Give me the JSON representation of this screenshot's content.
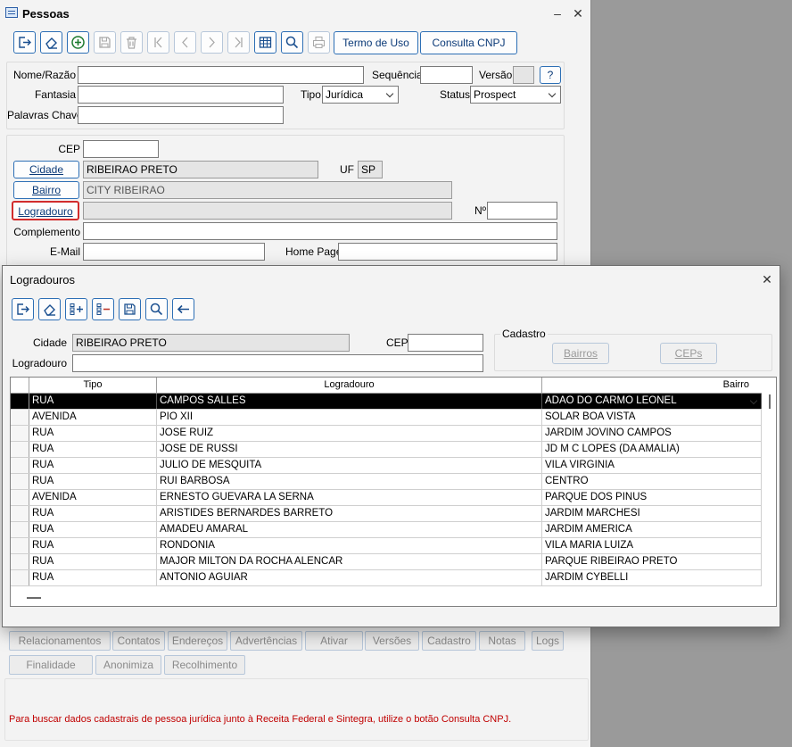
{
  "main": {
    "title": "Pessoas",
    "toolbar": {
      "termo_label": "Termo de Uso",
      "consulta_label": "Consulta CNPJ"
    },
    "form": {
      "nome_label": "Nome/Razão",
      "nome_value": "",
      "sequencia_label": "Sequência",
      "sequencia_value": "",
      "versao_label": "Versão",
      "versao_value": "",
      "help_label": "?",
      "fantasia_label": "Fantasia",
      "fantasia_value": "",
      "tipo_label": "Tipo",
      "tipo_value": "Jurídica",
      "status_label": "Status",
      "status_value": "Prospect",
      "palavras_label": "Palavras Chave",
      "palavras_value": ""
    },
    "address": {
      "cep_label": "CEP",
      "cep_value": "",
      "cidade_btn": "Cidade",
      "cidade_value": "RIBEIRAO PRETO",
      "uf_label": "UF",
      "uf_value": "SP",
      "bairro_btn": "Bairro",
      "bairro_value": "CITY RIBEIRAO",
      "logradouro_btn": "Logradouro",
      "logradouro_value": "",
      "numero_label": "Nº",
      "numero_value": "",
      "complemento_label": "Complemento",
      "complemento_value": "",
      "email_label": "E-Mail",
      "email_value": "",
      "homepage_label": "Home Page",
      "homepage_value": ""
    },
    "tabs_row1": [
      "Relacionamentos",
      "Contatos",
      "Endereços",
      "Advertências",
      "Ativar",
      "Versões",
      "Cadastro",
      "Notas",
      "Logs"
    ],
    "tabs_row2": [
      "Finalidade",
      "Anonimiza",
      "Recolhimento"
    ],
    "notice": "Para buscar dados cadastrais de pessoa jurídica junto à Receita Federal e Sintegra, utilize o botão Consulta CNPJ."
  },
  "dialog": {
    "title": "Logradouros",
    "cidade_label": "Cidade",
    "cidade_value": "RIBEIRAO PRETO",
    "cep_label": "CEP",
    "cep_value": "",
    "logradouro_label": "Logradouro",
    "logradouro_value": "",
    "cadastro_label": "Cadastro",
    "bairros_btn": "Bairros",
    "ceps_btn": "CEPs",
    "grid": {
      "columns": [
        "Tipo",
        "Logradouro",
        "Bairro"
      ],
      "rows": [
        [
          "RUA",
          "CAMPOS SALLES",
          "ADAO DO CARMO LEONEL"
        ],
        [
          "AVENIDA",
          "PIO XII",
          "SOLAR BOA VISTA"
        ],
        [
          "RUA",
          "JOSE RUIZ",
          "JARDIM JOVINO CAMPOS"
        ],
        [
          "RUA",
          "JOSE DE RUSSI",
          "JD M C LOPES (DA AMALIA)"
        ],
        [
          "RUA",
          "JULIO DE MESQUITA",
          "VILA VIRGINIA"
        ],
        [
          "RUA",
          "RUI BARBOSA",
          "CENTRO"
        ],
        [
          "AVENIDA",
          "ERNESTO GUEVARA LA SERNA",
          "PARQUE DOS PINUS"
        ],
        [
          "RUA",
          "ARISTIDES BERNARDES BARRETO",
          "JARDIM MARCHESI"
        ],
        [
          "RUA",
          "AMADEU AMARAL",
          "JARDIM AMERICA"
        ],
        [
          "RUA",
          "RONDONIA",
          "VILA MARIA LUIZA"
        ],
        [
          "RUA",
          "MAJOR MILTON DA ROCHA ALENCAR",
          "PARQUE RIBEIRAO PRETO"
        ],
        [
          "RUA",
          "ANTONIO AGUIAR",
          "JARDIM CYBELLI"
        ]
      ],
      "selected_row": 0
    }
  }
}
